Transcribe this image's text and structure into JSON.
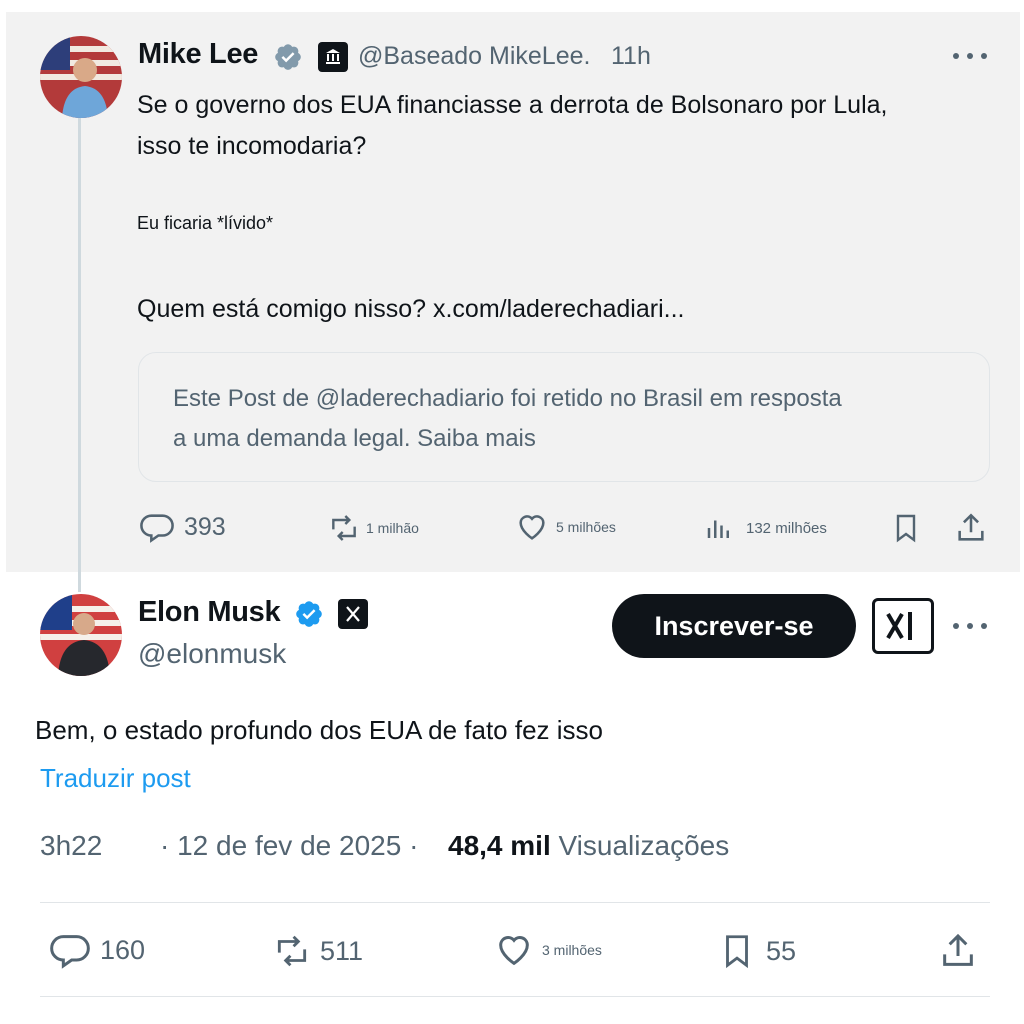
{
  "quoted_post": {
    "author_name": "Mike Lee",
    "handle": "@Baseado MikeLee.",
    "time": "11h",
    "line1": "Se o governo dos EUA financiasse a derrota de Bolsonaro por Lula,",
    "line2": "isso te incomodaria?",
    "aside": "Eu ficaria *lívido*",
    "line3": "Quem está comigo nisso? x.com/laderechadiari...",
    "withheld_line1": "Este Post de @laderechadiario foi retido no Brasil em resposta",
    "withheld_line2": "a uma demanda legal. Saiba mais",
    "replies": "393",
    "reposts": "1 milhão",
    "likes": "5 milhões",
    "views": "132 milhões"
  },
  "main_post": {
    "author_name": "Elon Musk",
    "handle": "@elonmusk",
    "subscribe_label": "Inscrever-se",
    "text": "Bem, o estado profundo dos EUA de fato fez isso",
    "translate_label": "Traduzir post",
    "time": "3h22",
    "date": "· 12 de fev de 2025 ·",
    "views_count": "48,4 mil",
    "views_label": "Visualizações",
    "replies": "160",
    "reposts": "511",
    "likes": "3 milhões",
    "bookmarks": "55"
  },
  "colors": {
    "link_blue": "#1d9bf0",
    "verified_blue": "#1d9bf0",
    "muted_grey": "#536471",
    "quoted_background": "#f2f2f2"
  },
  "icons": [
    "verified-icon",
    "government-icon",
    "x-logo-icon",
    "xai-logo-icon",
    "reply-icon",
    "repost-icon",
    "like-icon",
    "views-icon",
    "bookmark-icon",
    "share-icon",
    "more-icon"
  ]
}
